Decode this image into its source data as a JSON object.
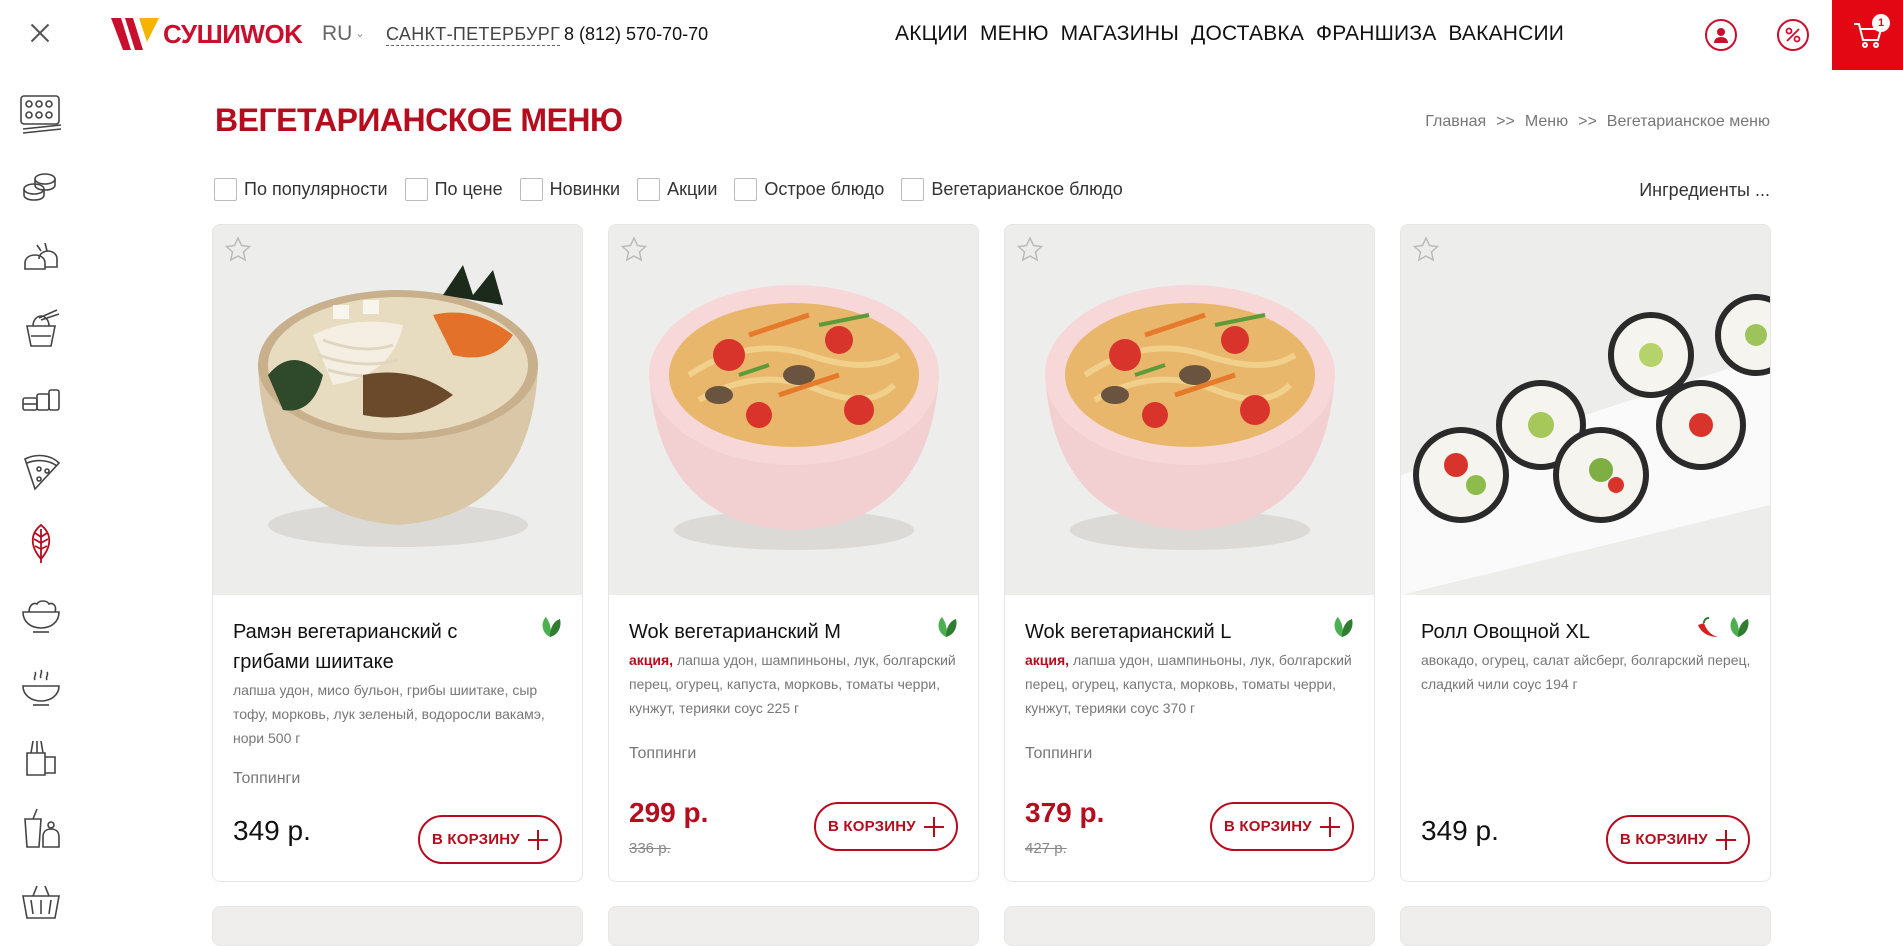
{
  "header": {
    "logo_text": "СУШИWOK",
    "language": "RU",
    "city": "САНКТ-ПЕТЕРБУРГ",
    "phone": "8 (812) 570-70-70",
    "nav": [
      "АКЦИИ",
      "МЕНЮ",
      "МАГАЗИНЫ",
      "ДОСТАВКА",
      "ФРАНШИЗА",
      "ВАКАНСИИ"
    ],
    "cart_count": "1",
    "brand_color": "#e30613",
    "accent_color": "#b50d1e"
  },
  "sidebar": {
    "icons": [
      "sets-icon",
      "rolls-icon",
      "sushi-icon",
      "wok-icon",
      "combo-icon",
      "pizza-icon",
      "vegetarian-leaf-icon",
      "salad-icon",
      "soup-icon",
      "snacks-icon",
      "drinks-desserts-icon",
      "basket-icon"
    ],
    "active": "vegetarian-leaf-icon"
  },
  "page": {
    "title": "ВЕГЕТАРИАНСКОЕ МЕНЮ",
    "breadcrumb": [
      "Главная",
      ">>",
      "Меню",
      ">>",
      "Вегетарианское меню"
    ]
  },
  "filters": {
    "items": [
      "По популярности",
      "По цене",
      "Новинки",
      "Акции",
      "Острое блюдо",
      "Вегетарианское блюдо"
    ],
    "ingredients": "Ингредиенты ..."
  },
  "products": [
    {
      "name": "Рамэн вегетарианский с грибами шиитаке",
      "promo": "",
      "description": "лапша удон, мисо бульон, грибы шиитаке, сыр тофу, морковь, лук зеленый, водоросли вакамэ, нори 500 г",
      "toppings": "Топпинги",
      "price": "349 р.",
      "old_price": "",
      "button": "В КОРЗИНУ",
      "tags": [
        "vegetarian"
      ]
    },
    {
      "name": "Wok вегетарианский M",
      "promo": "акция,",
      "description": "лапша удон, шампиньоны, лук, болгарский перец, огурец, капуста, морковь, томаты черри, кунжут, терияки соус 225 г",
      "toppings": "Топпинги",
      "price": "299 р.",
      "old_price": "336 р.",
      "button": "В КОРЗИНУ",
      "tags": [
        "vegetarian"
      ]
    },
    {
      "name": "Wok вегетарианский L",
      "promo": "акция,",
      "description": "лапша удон, шампиньоны, лук, болгарский перец, огурец, капуста, морковь, томаты черри, кунжут, терияки соус 370 г",
      "toppings": "Топпинги",
      "price": "379 р.",
      "old_price": "427 р.",
      "button": "В КОРЗИНУ",
      "tags": [
        "vegetarian"
      ]
    },
    {
      "name": "Ролл Овощной XL",
      "promo": "",
      "description": "авокадо, огурец, салат айсберг, болгарский перец, сладкий чили соус 194 г",
      "toppings": "",
      "price": "349 р.",
      "old_price": "",
      "button": "В КОРЗИНУ",
      "tags": [
        "spicy",
        "vegetarian"
      ]
    }
  ]
}
